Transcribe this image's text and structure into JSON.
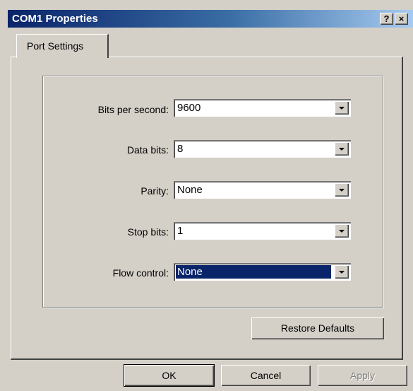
{
  "window": {
    "title": "COM1 Properties",
    "help_glyph": "?",
    "close_glyph": "×"
  },
  "tabs": [
    {
      "label": "Port Settings"
    }
  ],
  "settings": [
    {
      "label": "Bits per second:",
      "value": "9600"
    },
    {
      "label": "Data bits:",
      "value": "8"
    },
    {
      "label": "Parity:",
      "value": "None"
    },
    {
      "label": "Stop bits:",
      "value": "1"
    },
    {
      "label": "Flow control:",
      "value": "None"
    }
  ],
  "buttons": {
    "restore": "Restore Defaults",
    "ok": "OK",
    "cancel": "Cancel",
    "apply": "Apply"
  },
  "colors": {
    "face": "#d4d0c8",
    "title_active": "#0a246a",
    "selection": "#0a246a"
  },
  "icons": {
    "help": "help-icon",
    "close": "close-icon",
    "dropdown": "chevron-down-icon"
  }
}
